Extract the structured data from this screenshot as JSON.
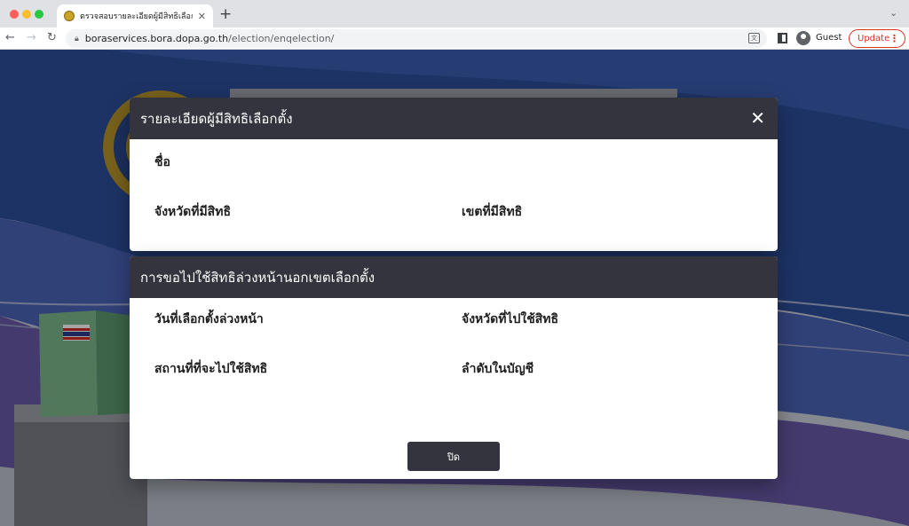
{
  "browser": {
    "tab_title": "ตรวจสอบรายละเอียดผู้มีสิทธิเลือกตั้ง",
    "url_host": "boraservices.bora.dopa.go.th",
    "url_path": "/election/enqelection/",
    "profile_name": "Guest",
    "update_label": "Update"
  },
  "modal_voter": {
    "title": "รายละเอียดผู้มีสิทธิเลือกตั้ง",
    "name_label": "ชื่อ",
    "province_label": "จังหวัดที่มีสิทธิ",
    "district_label": "เขตที่มีสิทธิ"
  },
  "modal_advance": {
    "title": "การขอไปใช้สิทธิล่วงหน้านอกเขตเลือกตั้ง",
    "advance_date_label": "วันที่เลือกตั้งล่วงหน้า",
    "vote_province_label": "จังหวัดที่ไปใช้สิทธิ",
    "polling_place_label": "สถานที่ที่จะไปใช้สิทธิ",
    "list_order_label": "ลำดับในบัญชี",
    "close_button_label": "ปิด"
  },
  "colors": {
    "modal_header": "#33343d",
    "update_accent": "#d93025",
    "page_blue": "#2d4f9c"
  },
  "icons": {
    "close": "close-icon",
    "lock": "lock-icon",
    "translate": "translate-icon",
    "avatar": "profile-avatar-icon"
  }
}
